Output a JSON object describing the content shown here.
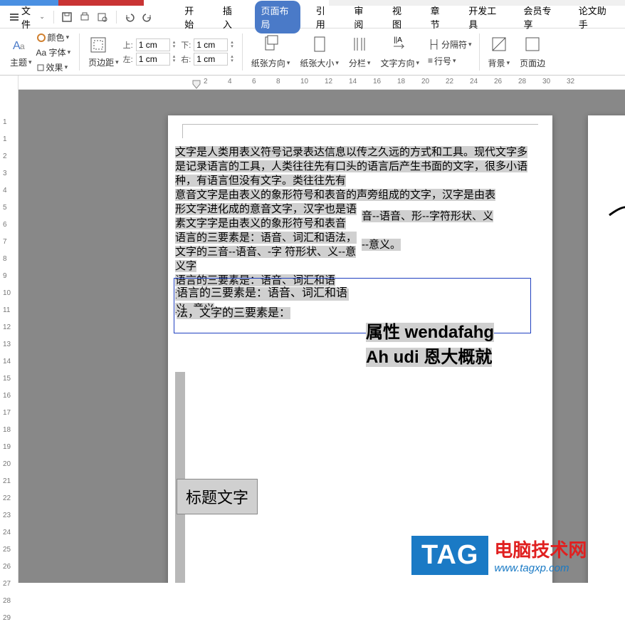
{
  "menu": {
    "file": "文件",
    "items": [
      "开始",
      "插入",
      "页面布局",
      "引用",
      "审阅",
      "视图",
      "章节",
      "开发工具",
      "会员专享",
      "论文助手"
    ],
    "active_index": 2
  },
  "ribbon": {
    "theme": "主题",
    "font_label": "Aa 字体",
    "color": "颜色",
    "effect": "效果",
    "page_margin": "页边距",
    "top": "上:",
    "top_v": "1 cm",
    "left": "左:",
    "left_v": "1 cm",
    "bottom": "下:",
    "bottom_v": "1 cm",
    "right": "右:",
    "right_v": "1 cm",
    "paper_dir": "纸张方向",
    "paper_size": "纸张大小",
    "columns": "分栏",
    "text_dir": "文字方向",
    "separator": "分隔符",
    "line_no": "行号",
    "background": "背景",
    "page_border": "页面边"
  },
  "ruler": {
    "h": [
      "2",
      "4",
      "6",
      "8",
      "10",
      "12",
      "14",
      "16",
      "18",
      "20",
      "22",
      "24",
      "26",
      "28",
      "30",
      "32"
    ],
    "v": [
      "1",
      "1",
      "2",
      "3",
      "4",
      "5",
      "6",
      "7",
      "8",
      "9",
      "10",
      "11",
      "12",
      "13",
      "14",
      "15",
      "16",
      "17",
      "18",
      "19",
      "20",
      "21",
      "22",
      "23",
      "24",
      "25",
      "26",
      "27",
      "28",
      "29"
    ]
  },
  "doc": {
    "p1": "文字是人类用表义符号记录表达信息以传之久远的方式和工具。现代文字多是记录语言的工具，人类往往先有口头的语言后产生书面的文字，很多小语种，有语言但没有文字。",
    "p2": "意音文字是由表义的象形符号和表音的声旁组成的文字，汉字是由表形文字进化成的意音文字，汉字也是语素文字",
    "p3": "语言的三要素是：语音、词汇和语法，文字的三音--语音、-字 符形状、义--意义",
    "r1": "音--语音、形--字符形状、义--意义。",
    "box_text": "语言的三要素是：语音、词汇和语法，文字的三要素是：",
    "big1": "属性 wendafahg",
    "big2": "Ah udi 恩大概就",
    "title_box": "标题文字"
  },
  "watermark": {
    "tag": "TAG",
    "cn": "电脑技术网",
    "url": "www.tagxp.com"
  }
}
